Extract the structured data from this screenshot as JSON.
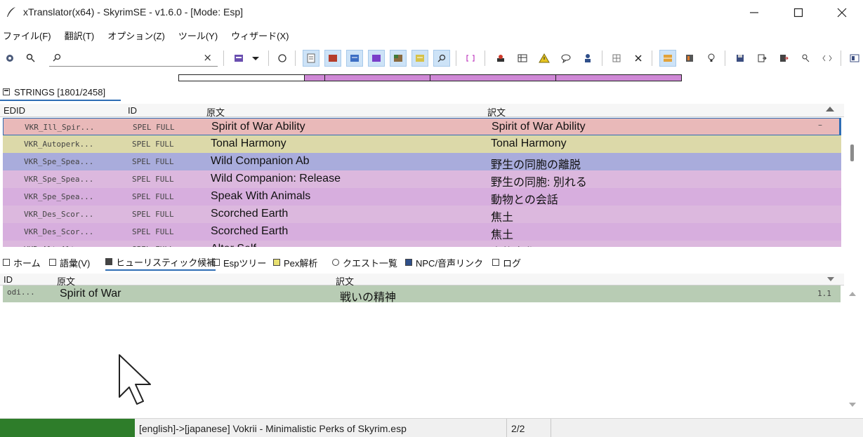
{
  "window": {
    "title": "xTranslator(x64) - SkyrimSE - v1.6.0 - [Mode: Esp]"
  },
  "menu": [
    "ファイル(F)",
    "翻訳(T)",
    "オプション(Z)",
    "ツール(Y)",
    "ウィザード(X)"
  ],
  "search": {
    "value": "",
    "clear_label": "×"
  },
  "progress": {
    "segments": [
      {
        "fraction_start": 0.0,
        "fraction_end": 0.25,
        "color": "#ffffff"
      },
      {
        "fraction_start": 0.25,
        "fraction_end": 1.0,
        "color": "#cf88d6"
      }
    ]
  },
  "strings_panel": {
    "title": "STRINGS [1801/2458]"
  },
  "strings_table": {
    "columns": [
      "EDID",
      "ID",
      "原文",
      "訳文"
    ],
    "rows": [
      {
        "edid": "VKR_Ill_Spir...",
        "id": "SPEL FULL",
        "source": "Spirit of War Ability",
        "dest": "Spirit of War Ability",
        "mark": "–",
        "color": "#e9b9b9"
      },
      {
        "edid": "VKR_Autoperk...",
        "id": "SPEL FULL",
        "source": "Tonal Harmony",
        "dest": "Tonal Harmony",
        "mark": "",
        "color": "#dcd9a9"
      },
      {
        "edid": "VKR_Spe_Spea...",
        "id": "SPEL FULL",
        "source": "Wild Companion Ab",
        "dest": "野生の同胞の離脱",
        "mark": "",
        "color": "#a9acdc"
      },
      {
        "edid": "VKR_Spe_Spea...",
        "id": "SPEL FULL",
        "source": "Wild Companion: Release",
        "dest": "野生の同胞: 別れる",
        "mark": "",
        "color": "#dcb8de"
      },
      {
        "edid": "VKR_Spe_Spea...",
        "id": "SPEL FULL",
        "source": "Speak With Animals",
        "dest": "動物との会話",
        "mark": "",
        "color": "#d7aede"
      },
      {
        "edid": "VKR_Des_Scor...",
        "id": "SPEL FULL",
        "source": "Scorched Earth",
        "dest": "焦土",
        "mark": "",
        "color": "#dcb8de"
      },
      {
        "edid": "VKR_Des_Scor...",
        "id": "SPEL FULL",
        "source": "Scorched Earth",
        "dest": "焦土",
        "mark": "",
        "color": "#d7aede"
      },
      {
        "edid": "VKR_Alt_Alt...",
        "id": "SPEL FULL",
        "source": "Alter Self",
        "dest": "姿態変化",
        "mark": "",
        "color": "#dcb8de"
      }
    ]
  },
  "tabs": [
    {
      "label": "ホーム",
      "icon": "home-icon"
    },
    {
      "label": "語彙(V)",
      "icon": "vocab-icon"
    },
    {
      "label": "ヒューリスティック候補",
      "icon": "heuristic-icon"
    },
    {
      "label": "Espツリー",
      "icon": "tree-icon"
    },
    {
      "label": "Pex解析",
      "icon": "pex-icon"
    },
    {
      "label": "クエスト一覧",
      "icon": "quest-icon"
    },
    {
      "label": "NPC/音声リンク",
      "icon": "npc-icon"
    },
    {
      "label": "ログ",
      "icon": "log-icon"
    }
  ],
  "heuristic_table": {
    "columns": [
      "ID",
      "原文",
      "訳文"
    ],
    "rows": [
      {
        "id": "odi...",
        "source": "Spirit of War",
        "dest": "戦いの精神",
        "score": "1.1"
      }
    ]
  },
  "status": {
    "message": "[english]->[japanese] Vokrii - Minimalistic Perks of Skyrim.esp",
    "count": "2/2",
    "progress_color": "#2e7d2a"
  }
}
